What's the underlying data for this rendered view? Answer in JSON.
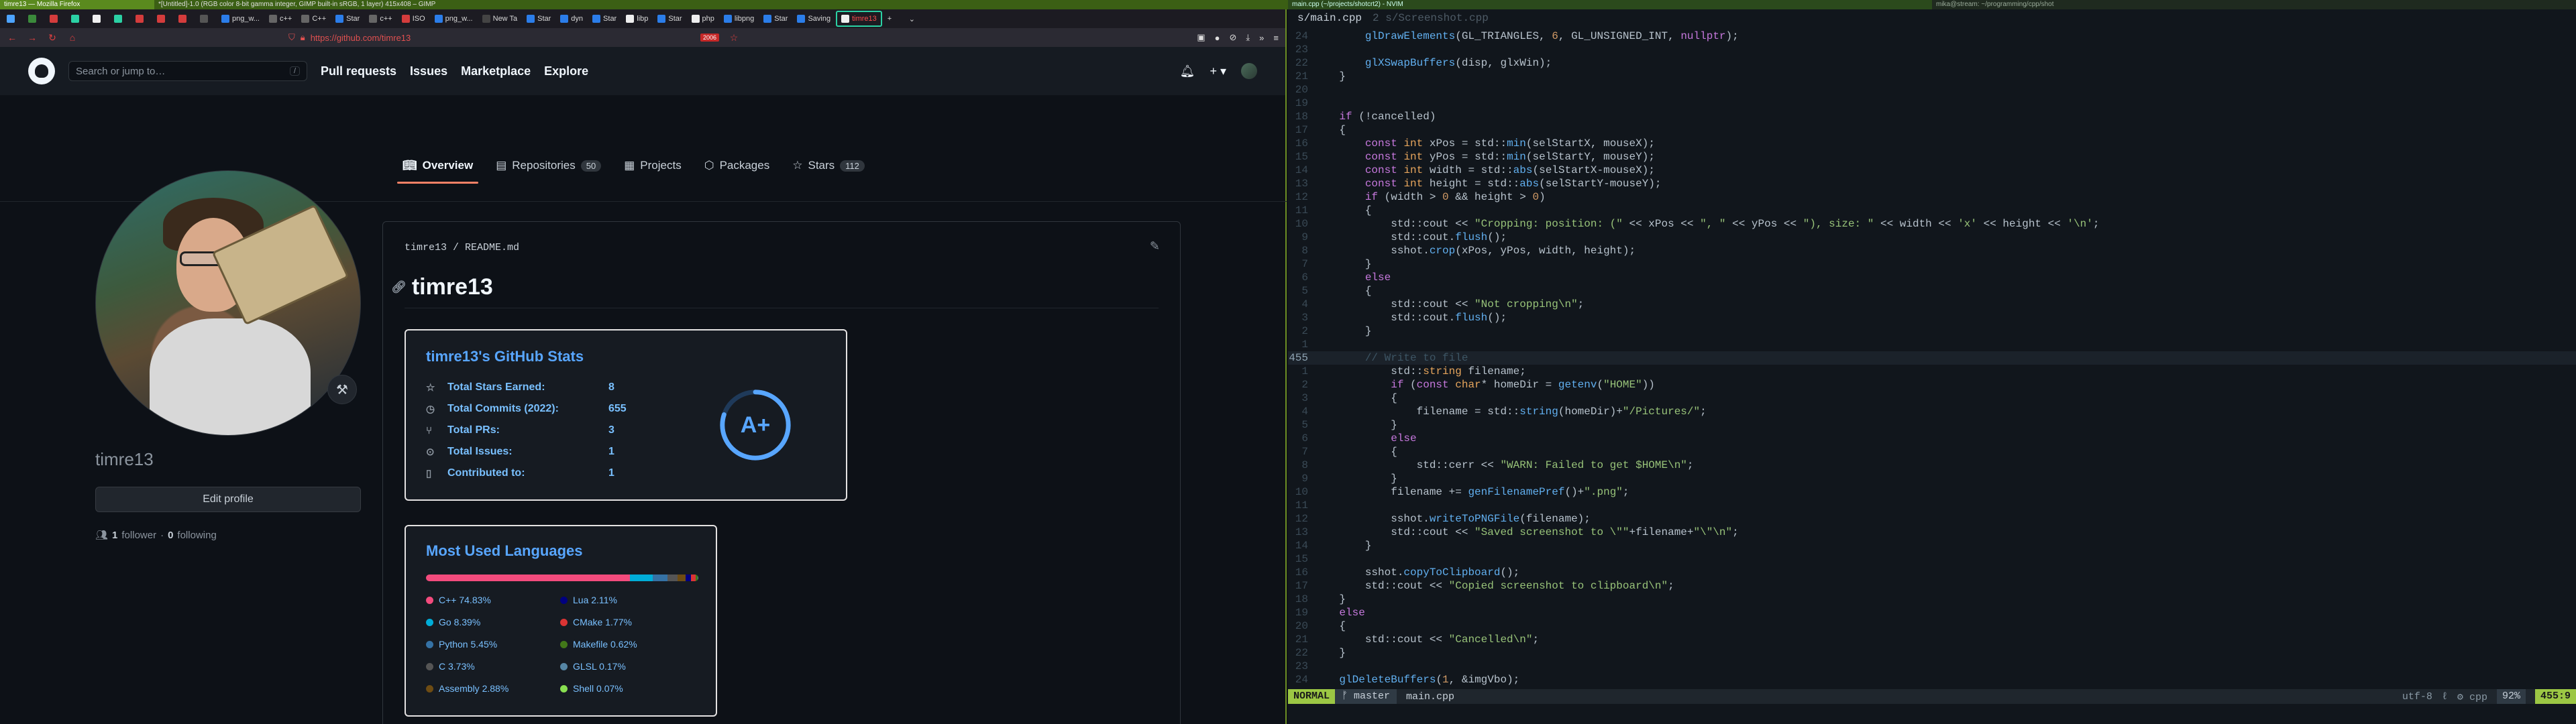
{
  "wm": {
    "firefox_title": "timre13 — Mozilla Firefox",
    "gimp_title": "*[Untitled]-1.0 (RGB color 8-bit gamma integer, GIMP built-in sRGB, 1 layer) 415x408 – GIMP",
    "nvim_title": "main.cpp (~/projects/shotcrt2) - NVIM",
    "term_title": "mika@stream: ~/programming/cpp/shot"
  },
  "browser": {
    "tabs": [
      {
        "label": "",
        "color": "#4da3ff"
      },
      {
        "label": "",
        "color": "#3b8a3b"
      },
      {
        "label": "",
        "color": "#d43c3c"
      },
      {
        "label": "",
        "color": "#2bd1a4"
      },
      {
        "label": "",
        "color": "#f0f0f0"
      },
      {
        "label": "",
        "color": "#2bd1a4"
      },
      {
        "label": "",
        "color": "#d43c3c"
      },
      {
        "label": "",
        "color": "#d43c3c"
      },
      {
        "label": "",
        "color": "#d43c3c"
      },
      {
        "label": "",
        "color": "#555"
      },
      {
        "label": "png_w...",
        "color": "#2b7de9"
      },
      {
        "label": "c++",
        "color": "#666"
      },
      {
        "label": "C++",
        "color": "#666"
      },
      {
        "label": "Star",
        "color": "#2b7de9"
      },
      {
        "label": "c++",
        "color": "#666"
      },
      {
        "label": "ISO",
        "color": "#d43c3c"
      },
      {
        "label": "png_w...",
        "color": "#2b7de9"
      },
      {
        "label": "New Ta",
        "color": "#444"
      },
      {
        "label": "Star",
        "color": "#2b7de9"
      },
      {
        "label": "dyn",
        "color": "#2b7de9"
      },
      {
        "label": "Star",
        "color": "#2b7de9"
      },
      {
        "label": "libp",
        "color": "#eee"
      },
      {
        "label": "Star",
        "color": "#2b7de9"
      },
      {
        "label": "php",
        "color": "#eee"
      },
      {
        "label": "libpng",
        "color": "#2b7de9"
      },
      {
        "label": "Star",
        "color": "#2b7de9"
      },
      {
        "label": "Saving",
        "color": "#2b7de9"
      }
    ],
    "active_tab": "timre13",
    "url": "https://github.com/timre13",
    "badge": "2006"
  },
  "gh": {
    "search_placeholder": "Search or jump to…",
    "search_key": "/",
    "nav": [
      "Pull requests",
      "Issues",
      "Marketplace",
      "Explore"
    ],
    "plus": "+ ▾",
    "tabs": [
      {
        "label": "Overview",
        "count": ""
      },
      {
        "label": "Repositories",
        "count": "50"
      },
      {
        "label": "Projects",
        "count": ""
      },
      {
        "label": "Packages",
        "count": ""
      },
      {
        "label": "Stars",
        "count": "112"
      }
    ],
    "username": "timre13",
    "edit_profile": "Edit profile",
    "followers_count": "1",
    "followers_label": "follower",
    "following_count": "0",
    "following_label": "following",
    "readme_user": "timre13",
    "readme_file": "README",
    "readme_ext": ".md",
    "readme_title": "timre13",
    "stats": {
      "title": "timre13's GitHub Stats",
      "rows": [
        {
          "label": "Total Stars Earned:",
          "value": "8"
        },
        {
          "label": "Total Commits (2022):",
          "value": "655"
        },
        {
          "label": "Total PRs:",
          "value": "3"
        },
        {
          "label": "Total Issues:",
          "value": "1"
        },
        {
          "label": "Contributed to:",
          "value": "1"
        }
      ],
      "grade": "A+",
      "grade_progress": 0.8
    },
    "langs": {
      "title": "Most Used Languages",
      "items": [
        {
          "name": "C++",
          "pct": "74.83%",
          "color": "#f34b7d",
          "value": 74.83
        },
        {
          "name": "Go",
          "pct": "8.39%",
          "color": "#00add8",
          "value": 8.39
        },
        {
          "name": "Python",
          "pct": "5.45%",
          "color": "#3572a5",
          "value": 5.45
        },
        {
          "name": "C",
          "pct": "3.73%",
          "color": "#555555",
          "value": 3.73
        },
        {
          "name": "Assembly",
          "pct": "2.88%",
          "color": "#6e4c13",
          "value": 2.88
        },
        {
          "name": "Lua",
          "pct": "2.11%",
          "color": "#000080",
          "value": 2.11
        },
        {
          "name": "CMake",
          "pct": "1.77%",
          "color": "#da3434",
          "value": 1.77
        },
        {
          "name": "Makefile",
          "pct": "0.62%",
          "color": "#427819",
          "value": 0.62
        },
        {
          "name": "GLSL",
          "pct": "0.17%",
          "color": "#5686a5",
          "value": 0.17
        },
        {
          "name": "Shell",
          "pct": "0.07%",
          "color": "#89e051",
          "value": 0.07
        }
      ]
    }
  },
  "editor": {
    "file_path": "s/main.cpp",
    "other_file": "2 s/Screenshot.cpp",
    "lines": [
      {
        "n": "24",
        "html": "        <span class=\"fn\">glDrawElements</span>(GL_TRIANGLES, <span class=\"nu\">6</span>, GL_UNSIGNED_INT, <span class=\"kw\">nullptr</span>);"
      },
      {
        "n": "23",
        "html": ""
      },
      {
        "n": "22",
        "html": "        <span class=\"fn\">glXSwapBuffers</span>(disp, glxWin);"
      },
      {
        "n": "21",
        "html": "    }"
      },
      {
        "n": "20",
        "html": ""
      },
      {
        "n": "19",
        "html": ""
      },
      {
        "n": "18",
        "html": "    <span class=\"kw\">if</span> (!cancelled)"
      },
      {
        "n": "17",
        "html": "    {"
      },
      {
        "n": "16",
        "html": "        <span class=\"kw\">const</span> <span class=\"ty\">int</span> xPos = std::<span class=\"fn\">min</span>(selStartX, mouseX);"
      },
      {
        "n": "15",
        "html": "        <span class=\"kw\">const</span> <span class=\"ty\">int</span> yPos = std::<span class=\"fn\">min</span>(selStartY, mouseY);"
      },
      {
        "n": "14",
        "html": "        <span class=\"kw\">const</span> <span class=\"ty\">int</span> width = std::<span class=\"fn\">abs</span>(selStartX-mouseX);"
      },
      {
        "n": "13",
        "html": "        <span class=\"kw\">const</span> <span class=\"ty\">int</span> height = std::<span class=\"fn\">abs</span>(selStartY-mouseY);"
      },
      {
        "n": "12",
        "html": "        <span class=\"kw\">if</span> (width > <span class=\"nu\">0</span> && height > <span class=\"nu\">0</span>)"
      },
      {
        "n": "11",
        "html": "        {"
      },
      {
        "n": "10",
        "html": "            std::cout << <span class=\"st\">\"Cropping: position: (\"</span> << xPos << <span class=\"st\">\", \"</span> << yPos << <span class=\"st\">\"), size: \"</span> << width << <span class=\"st\">'x'</span> << height << <span class=\"st\">'\\n'</span>;"
      },
      {
        "n": "9",
        "html": "            std::cout.<span class=\"fn\">flush</span>();"
      },
      {
        "n": "8",
        "html": "            sshot.<span class=\"fn\">crop</span>(xPos, yPos, width, height);"
      },
      {
        "n": "7",
        "html": "        }"
      },
      {
        "n": "6",
        "html": "        <span class=\"kw\">else</span>"
      },
      {
        "n": "5",
        "html": "        {"
      },
      {
        "n": "4",
        "html": "            std::cout << <span class=\"st\">\"Not cropping\\n\"</span>;"
      },
      {
        "n": "3",
        "html": "            std::cout.<span class=\"fn\">flush</span>();"
      },
      {
        "n": "2",
        "html": "        }"
      },
      {
        "n": "1",
        "html": ""
      },
      {
        "n": "455",
        "html": "        <span class=\"cm\">// Write to file</span>",
        "cur": true
      },
      {
        "n": "1",
        "html": "            std::<span class=\"ty\">string</span> filename;"
      },
      {
        "n": "2",
        "html": "            <span class=\"kw\">if</span> (<span class=\"kw\">const</span> <span class=\"ty\">char</span>* homeDir = <span class=\"fn\">getenv</span>(<span class=\"st\">\"HOME\"</span>))"
      },
      {
        "n": "3",
        "html": "            {"
      },
      {
        "n": "4",
        "html": "                filename = std::<span class=\"fn\">string</span>(homeDir)+<span class=\"st\">\"/Pictures/\"</span>;"
      },
      {
        "n": "5",
        "html": "            }"
      },
      {
        "n": "6",
        "html": "            <span class=\"kw\">else</span>"
      },
      {
        "n": "7",
        "html": "            {"
      },
      {
        "n": "8",
        "html": "                std::cerr << <span class=\"st\">\"WARN: Failed to get $HOME\\n\"</span>;"
      },
      {
        "n": "9",
        "html": "            }"
      },
      {
        "n": "10",
        "html": "            filename += <span class=\"fn\">genFilenamePref</span>()+<span class=\"st\">\".png\"</span>;"
      },
      {
        "n": "11",
        "html": ""
      },
      {
        "n": "12",
        "html": "            sshot.<span class=\"fn\">writeToPNGFile</span>(filename);"
      },
      {
        "n": "13",
        "html": "            std::cout << <span class=\"st\">\"Saved screenshot to \\\"\"</span>+filename+<span class=\"st\">\"\\\"\\n\"</span>;"
      },
      {
        "n": "14",
        "html": "        }"
      },
      {
        "n": "15",
        "html": ""
      },
      {
        "n": "16",
        "html": "        sshot.<span class=\"fn\">copyToClipboard</span>();"
      },
      {
        "n": "17",
        "html": "        std::cout << <span class=\"st\">\"Copied screenshot to clipboard\\n\"</span>;"
      },
      {
        "n": "18",
        "html": "    }"
      },
      {
        "n": "19",
        "html": "    <span class=\"kw\">else</span>"
      },
      {
        "n": "20",
        "html": "    {"
      },
      {
        "n": "21",
        "html": "        std::cout << <span class=\"st\">\"Cancelled\\n\"</span>;"
      },
      {
        "n": "22",
        "html": "    }"
      },
      {
        "n": "23",
        "html": ""
      },
      {
        "n": "24",
        "html": "    <span class=\"fn\">glDeleteBuffers</span>(<span class=\"nu\">1</span>, &imgVbo);"
      }
    ],
    "mode": "NORMAL",
    "branch": "ᚠ master",
    "filename": "main.cpp",
    "encoding": "utf-8",
    "fileformat": "ℓ",
    "filetype": "⚙ cpp",
    "percent": "92%",
    "position": "455:9"
  },
  "colors": {
    "accent": "#58a6ff",
    "tab_underline": "#f78166",
    "nvim_mode": "#9cc744",
    "grade_ring": "#58a6ff"
  }
}
